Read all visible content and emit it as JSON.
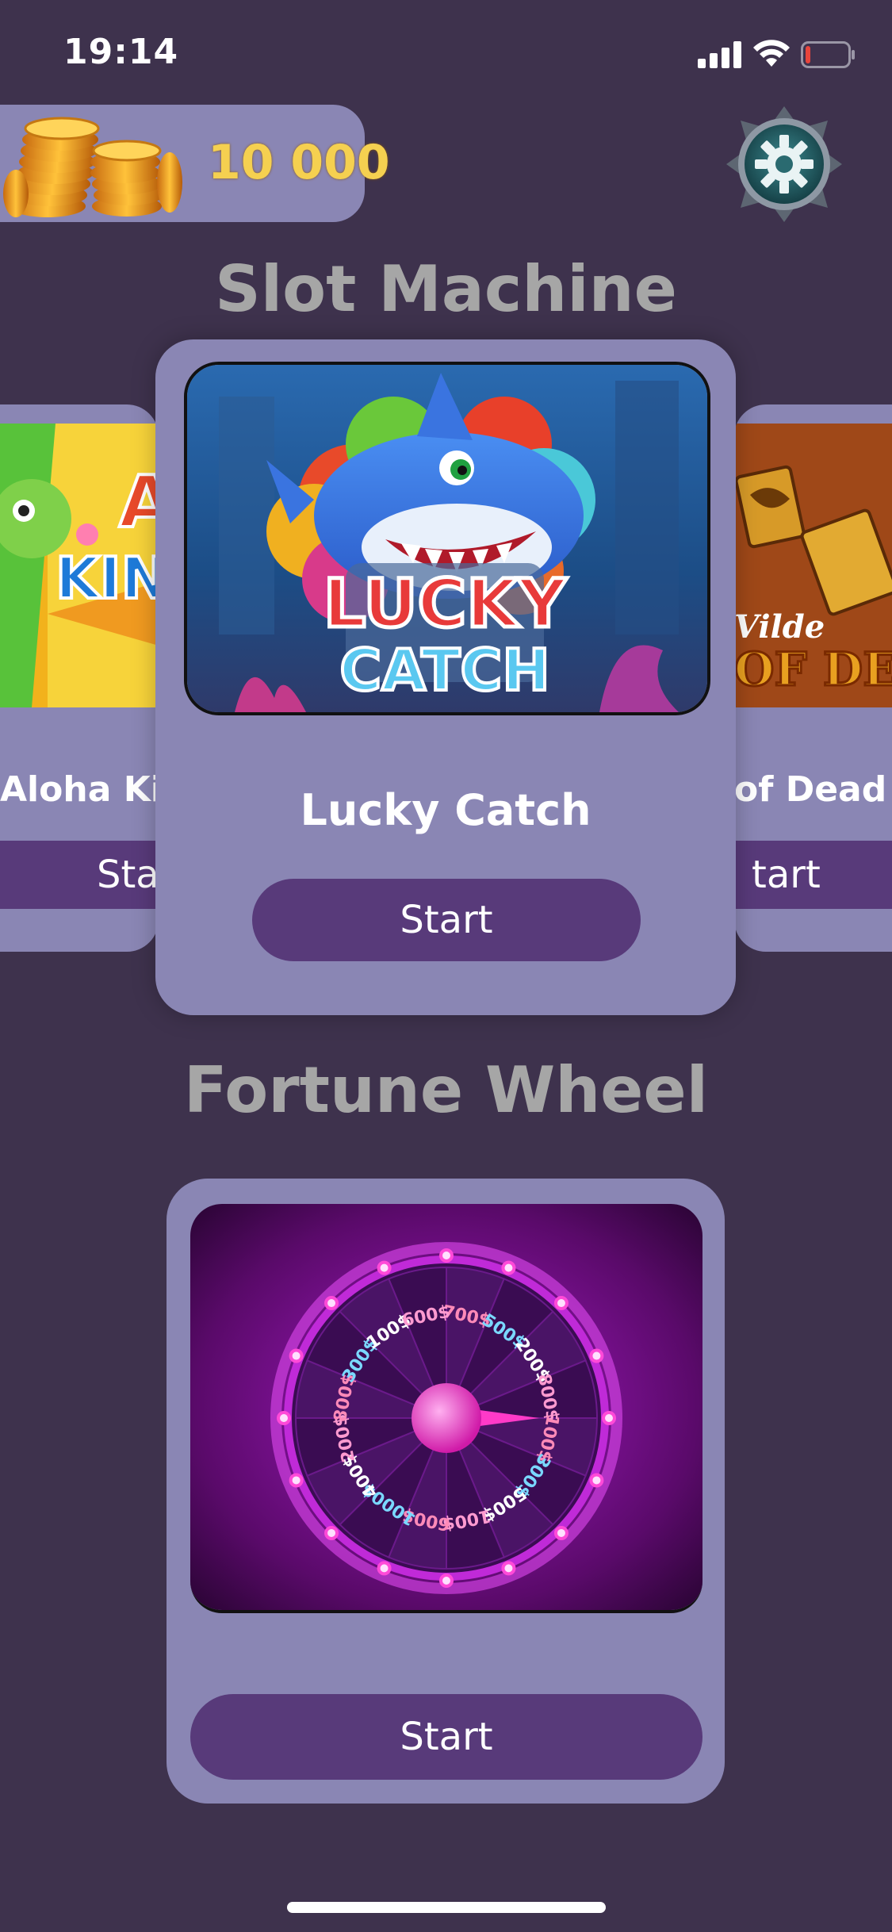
{
  "status_bar": {
    "time": "19:14"
  },
  "header": {
    "coins": "10 000",
    "settings_icon": "gear-icon"
  },
  "slot_section": {
    "title": "Slot Machine",
    "games": [
      {
        "label": "Aloha Kin",
        "start": "Star"
      },
      {
        "label": "Lucky Catch",
        "start": "Start",
        "logo_line1": "LUCKY",
        "logo_line2": "CATCH"
      },
      {
        "label": "of Dead",
        "start": "tart",
        "art_text": "OF DEA"
      }
    ]
  },
  "wheel_section": {
    "title": "Fortune Wheel",
    "start": "Start",
    "prizes": [
      "700$",
      "500$",
      "200$",
      "800$",
      "100$",
      "300$",
      "500$",
      "100$",
      "600$",
      "1000$",
      "400$",
      "200$",
      "800$",
      "300$",
      "100$",
      "600$"
    ]
  },
  "colors": {
    "background": "#3e324d",
    "card": "#8a86b4",
    "button": "#583a7a",
    "coins_text": "#f5d050"
  }
}
